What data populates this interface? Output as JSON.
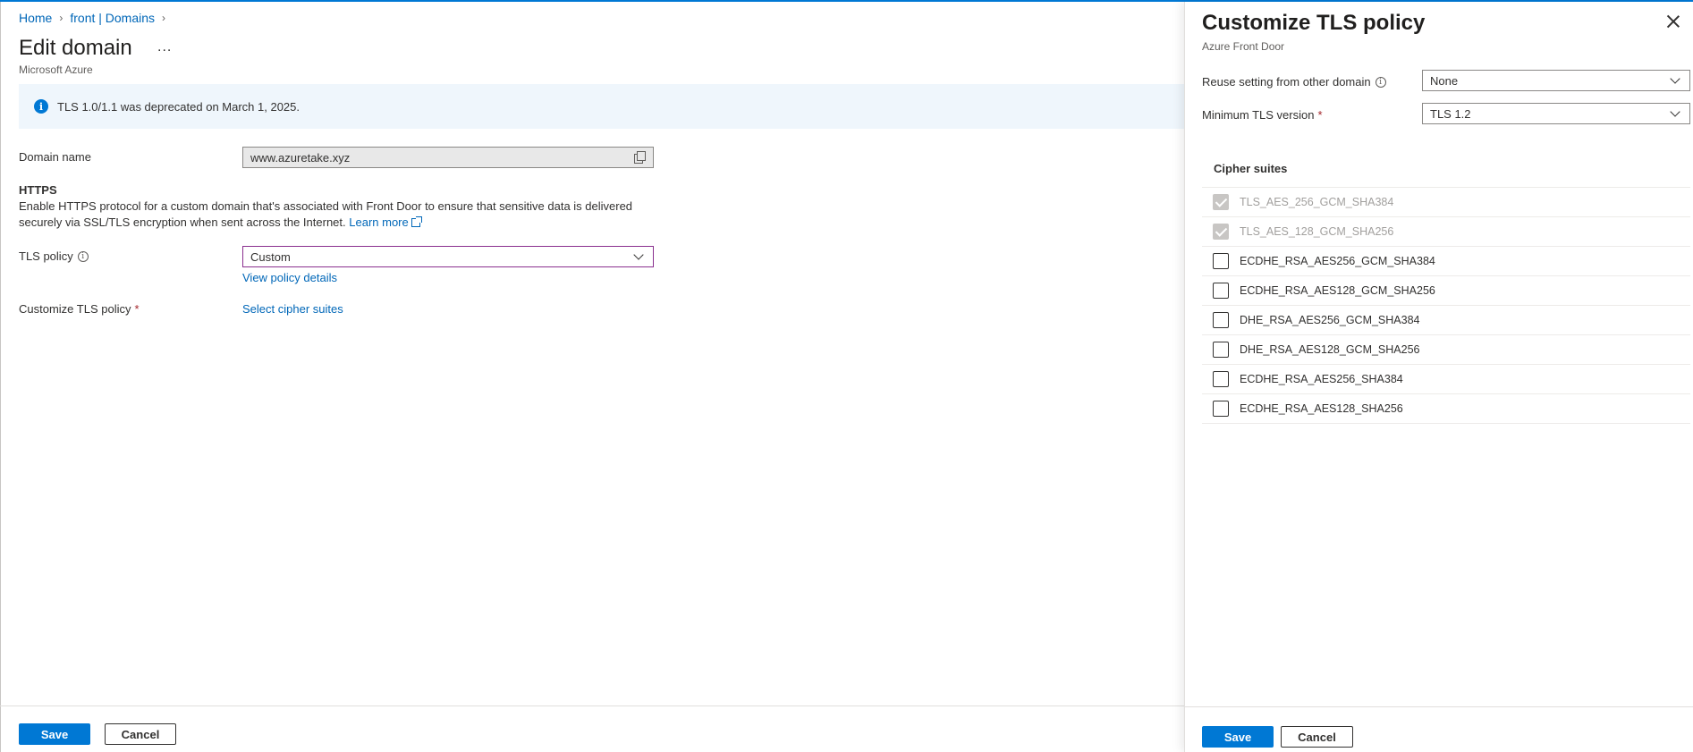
{
  "breadcrumb": {
    "home": "Home",
    "parent": "front | Domains"
  },
  "page": {
    "title": "Edit domain",
    "more": "...",
    "subtitle": "Microsoft Azure"
  },
  "banner": {
    "text": "TLS 1.0/1.1 was deprecated on March 1, 2025."
  },
  "form": {
    "domain_name_label": "Domain name",
    "domain_name_value": "www.azuretake.xyz",
    "https_heading": "HTTPS",
    "https_description": "Enable HTTPS protocol for a custom domain that's associated with Front Door to ensure that sensitive data is delivered securely via SSL/TLS encryption when sent across the Internet.",
    "learn_more": "Learn more",
    "tls_policy_label": "TLS policy",
    "tls_policy_value": "Custom",
    "view_policy_details": "View policy details",
    "customize_label": "Customize TLS policy",
    "select_cipher_suites": "Select cipher suites"
  },
  "footer": {
    "save": "Save",
    "cancel": "Cancel"
  },
  "panel": {
    "title": "Customize TLS policy",
    "subtitle": "Azure Front Door",
    "reuse_label": "Reuse setting from other domain",
    "reuse_value": "None",
    "min_tls_label": "Minimum TLS version",
    "min_tls_value": "TLS 1.2",
    "cipher_heading": "Cipher suites",
    "ciphers": [
      {
        "name": "TLS_AES_256_GCM_SHA384",
        "checked": true,
        "disabled": true
      },
      {
        "name": "TLS_AES_128_GCM_SHA256",
        "checked": true,
        "disabled": true
      },
      {
        "name": "ECDHE_RSA_AES256_GCM_SHA384",
        "checked": false,
        "disabled": false
      },
      {
        "name": "ECDHE_RSA_AES128_GCM_SHA256",
        "checked": false,
        "disabled": false
      },
      {
        "name": "DHE_RSA_AES256_GCM_SHA384",
        "checked": false,
        "disabled": false
      },
      {
        "name": "DHE_RSA_AES128_GCM_SHA256",
        "checked": false,
        "disabled": false
      },
      {
        "name": "ECDHE_RSA_AES256_SHA384",
        "checked": false,
        "disabled": false
      },
      {
        "name": "ECDHE_RSA_AES128_SHA256",
        "checked": false,
        "disabled": false
      }
    ],
    "save": "Save",
    "cancel": "Cancel"
  },
  "colors": {
    "accent": "#0078d4",
    "link": "#0067b8",
    "banner_bg": "#eff6fc",
    "focus_border": "#8a2f8f"
  },
  "icons": [
    "info-icon",
    "copy-icon",
    "external-link-icon",
    "chevron-down-icon",
    "close-icon",
    "checkbox-icon"
  ]
}
